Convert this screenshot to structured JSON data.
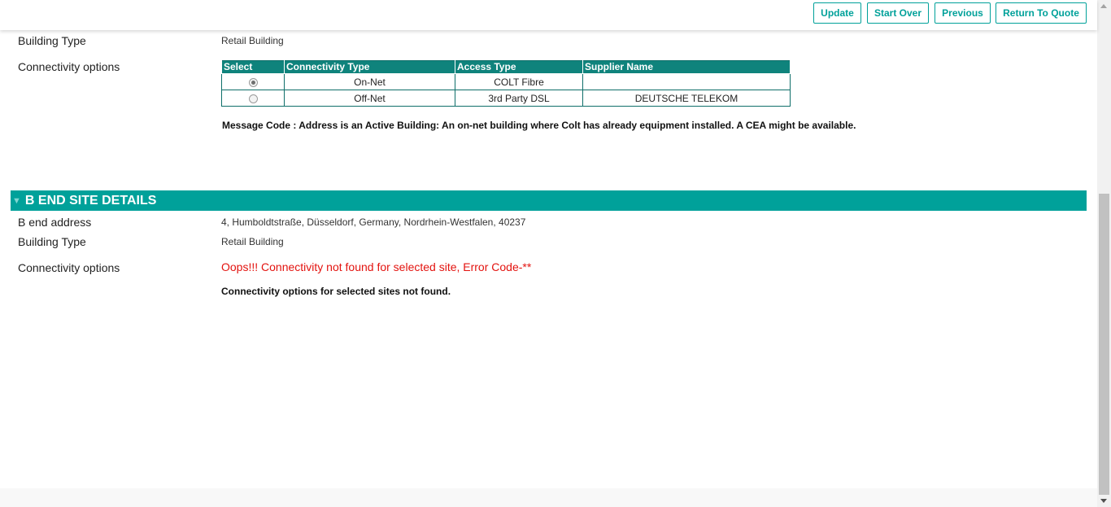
{
  "toolbar": {
    "update": "Update",
    "start_over": "Start Over",
    "previous": "Previous",
    "return_to_quote": "Return To Quote"
  },
  "a_end": {
    "building_type_label": "Building Type",
    "building_type_value": "Retail Building",
    "connectivity_label": "Connectivity options",
    "table": {
      "headers": [
        "Select",
        "Connectivity Type",
        "Access Type",
        "Supplier Name"
      ],
      "rows": [
        {
          "connectivity_type": "On-Net",
          "access_type": "COLT Fibre",
          "supplier_name": ""
        },
        {
          "connectivity_type": "Off-Net",
          "access_type": "3rd Party DSL",
          "supplier_name": "DEUTSCHE TELEKOM"
        }
      ]
    },
    "message": "Message Code : Address is an Active Building: An on-net building where Colt has already equipment installed. A CEA might be available."
  },
  "b_end": {
    "section_title": "B END SITE DETAILS",
    "address_label": "B end address",
    "address_value": "4, Humboldtstraße, Düsseldorf, Germany, Nordrhein-Westfalen, 40237",
    "building_type_label": "Building Type",
    "building_type_value": "Retail Building",
    "connectivity_label": "Connectivity options",
    "error": "Oops!!! Connectivity not found for selected site, Error Code-**",
    "not_found": "Connectivity options for selected sites not found."
  },
  "colors": {
    "accent": "#00a19a",
    "table_header": "#0f837c",
    "error": "#e3130f"
  }
}
